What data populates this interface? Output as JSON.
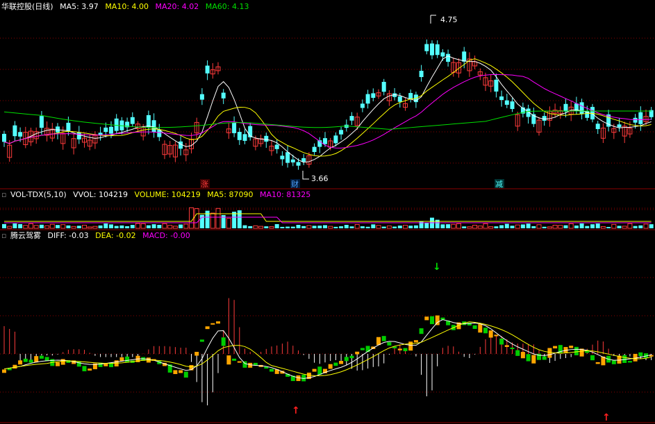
{
  "colors": {
    "up": "#ff3b3b",
    "down": "#54ffff",
    "ma5": "#ffffff",
    "ma10": "#ffff00",
    "ma20": "#ff00ff",
    "ma60": "#00e000",
    "grid": "#8b0000",
    "macd_orange": "#ffa500",
    "macd_green": "#00cc00"
  },
  "price_panel": {
    "title": "华联控股(日线)",
    "ma5": "MA5: 3.97",
    "ma10": "MA10: 4.00",
    "ma20": "MA20: 4.02",
    "ma60": "MA60: 4.13",
    "high_label": "4.75",
    "low_label": "3.66",
    "markers": [
      {
        "text": "涨",
        "color": "#ff3b3b"
      },
      {
        "text": "财",
        "color": "#4fa3ff"
      },
      {
        "text": "减",
        "color": "#54ffff"
      }
    ]
  },
  "volume_panel": {
    "title": "VOL-TDX(5,10)",
    "vvol": "VVOL: 104219",
    "volume": "VOLUME: 104219",
    "ma5": "MA5: 87090",
    "ma10": "MA10: 81325"
  },
  "macd_panel": {
    "title": "腾云驾雾",
    "diff": "DIFF: -0.03",
    "dea": "DEA: -0.02",
    "macd": "MACD: -0.00"
  },
  "arrows": [
    {
      "text": "↓",
      "color": "#00e000"
    },
    {
      "text": "↑",
      "color": "#ff2020"
    },
    {
      "text": "↑",
      "color": "#ff2020"
    }
  ]
}
